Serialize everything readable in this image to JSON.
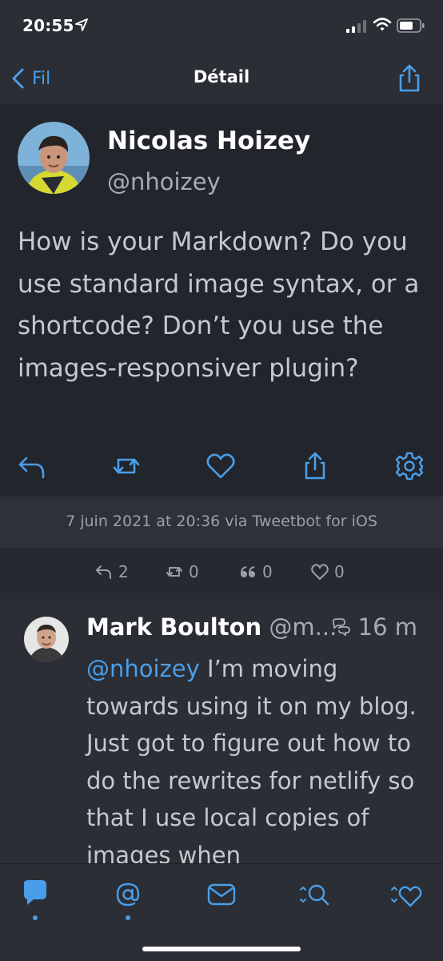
{
  "status_bar": {
    "time": "20:55",
    "icons": [
      "location-arrow-icon",
      "signal-icon",
      "wifi-icon",
      "battery-icon"
    ]
  },
  "nav": {
    "back_label": "Fil",
    "title": "Détail"
  },
  "tweet": {
    "author_name": "Nicolas Hoizey",
    "author_handle": "@nhoizey",
    "text": "How is your Markdown? Do you use standard image syntax, or a shortcode? Don’t you use the images-responsiver plugin?",
    "meta": "7 juin 2021 at 20:36 via Tweetbot for iOS",
    "stats": {
      "replies": "2",
      "retweets": "0",
      "quotes": "0",
      "likes": "0"
    }
  },
  "reply": {
    "name": "Mark Boulton",
    "handle": "@m...",
    "time": "16 m",
    "mention": "@nhoizey",
    "text": " I’m moving towards using it on my blog. Just got to figure out how to do the rewrites for netlify so that I use local copies of images when"
  },
  "colors": {
    "accent": "#4a9ee9",
    "background": "#2b2e35",
    "tweet_background": "#22252b"
  }
}
